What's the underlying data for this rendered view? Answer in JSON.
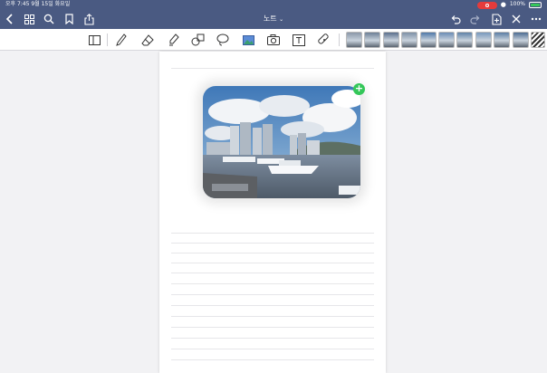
{
  "status": {
    "time": "오후 7:45",
    "date": "9월 15일 화요일",
    "battery": "100%"
  },
  "nav": {
    "title": "노트",
    "icons": [
      "chevron-left-icon",
      "grid-icon",
      "search-icon",
      "bookmark-icon",
      "share-icon",
      "undo-icon",
      "redo-icon",
      "add-page-icon",
      "close-icon",
      "more-icon"
    ]
  },
  "toolbar": {
    "tools": [
      "sidebar-icon",
      "pen-icon",
      "eraser-icon",
      "highlighter-icon",
      "shapes-icon",
      "lasso-icon",
      "image-icon",
      "camera-icon",
      "text-icon",
      "elements-icon"
    ],
    "sticker_count": 10
  },
  "colors": {
    "topbar": "#4a5a82",
    "plus": "#34c759",
    "record": "#e53b3b"
  }
}
